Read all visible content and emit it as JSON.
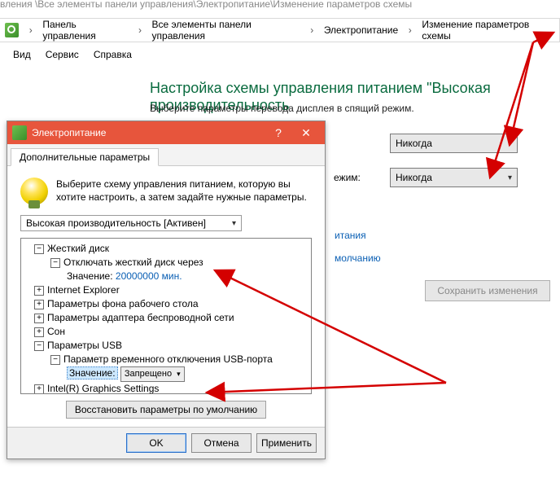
{
  "window_title_cut": "вления \\Все элементы панели управления\\Электропитание\\Изменение параметров схемы",
  "breadcrumb": {
    "items": [
      "Панель управления",
      "Все элементы панели управления",
      "Электропитание",
      "Изменение параметров схемы"
    ]
  },
  "menu": {
    "view": "Вид",
    "service": "Сервис",
    "help": "Справка"
  },
  "page": {
    "title": "Настройка схемы управления питанием \"Высокая производительность",
    "sub": "Выберите параметры перевода дисплея в спящий режим.",
    "mode_suffix": "ежим:",
    "never": "Никогда",
    "link_power": "итания",
    "link_defaults": "молчанию",
    "save": "Сохранить изменения"
  },
  "dialog": {
    "title": "Электропитание",
    "tab": "Дополнительные параметры",
    "intro": "Выберите схему управления питанием, которую вы хотите настроить, а затем задайте нужные параметры.",
    "scheme": "Высокая производительность [Активен]",
    "restore_defaults": "Восстановить параметры по умолчанию",
    "ok": "OK",
    "cancel": "Отмена",
    "apply": "Применить",
    "tree": {
      "hdd": "Жесткий диск",
      "hdd_off": "Отключать жесткий диск через",
      "hdd_val_label": "Значение:",
      "hdd_val": "20000000 мин.",
      "ie": "Internet Explorer",
      "bg": "Параметры фона рабочего стола",
      "wifi": "Параметры адаптера беспроводной сети",
      "sleep": "Сон",
      "usb": "Параметры USB",
      "usb_sub": "Параметр временного отключения USB-порта",
      "usb_val_label": "Значение:",
      "usb_val": "Запрещено",
      "intel": "Intel(R) Graphics Settings"
    }
  },
  "colors": {
    "accent": "#e7553c",
    "link": "#0a5fb4",
    "heading": "#0a6b3f"
  }
}
